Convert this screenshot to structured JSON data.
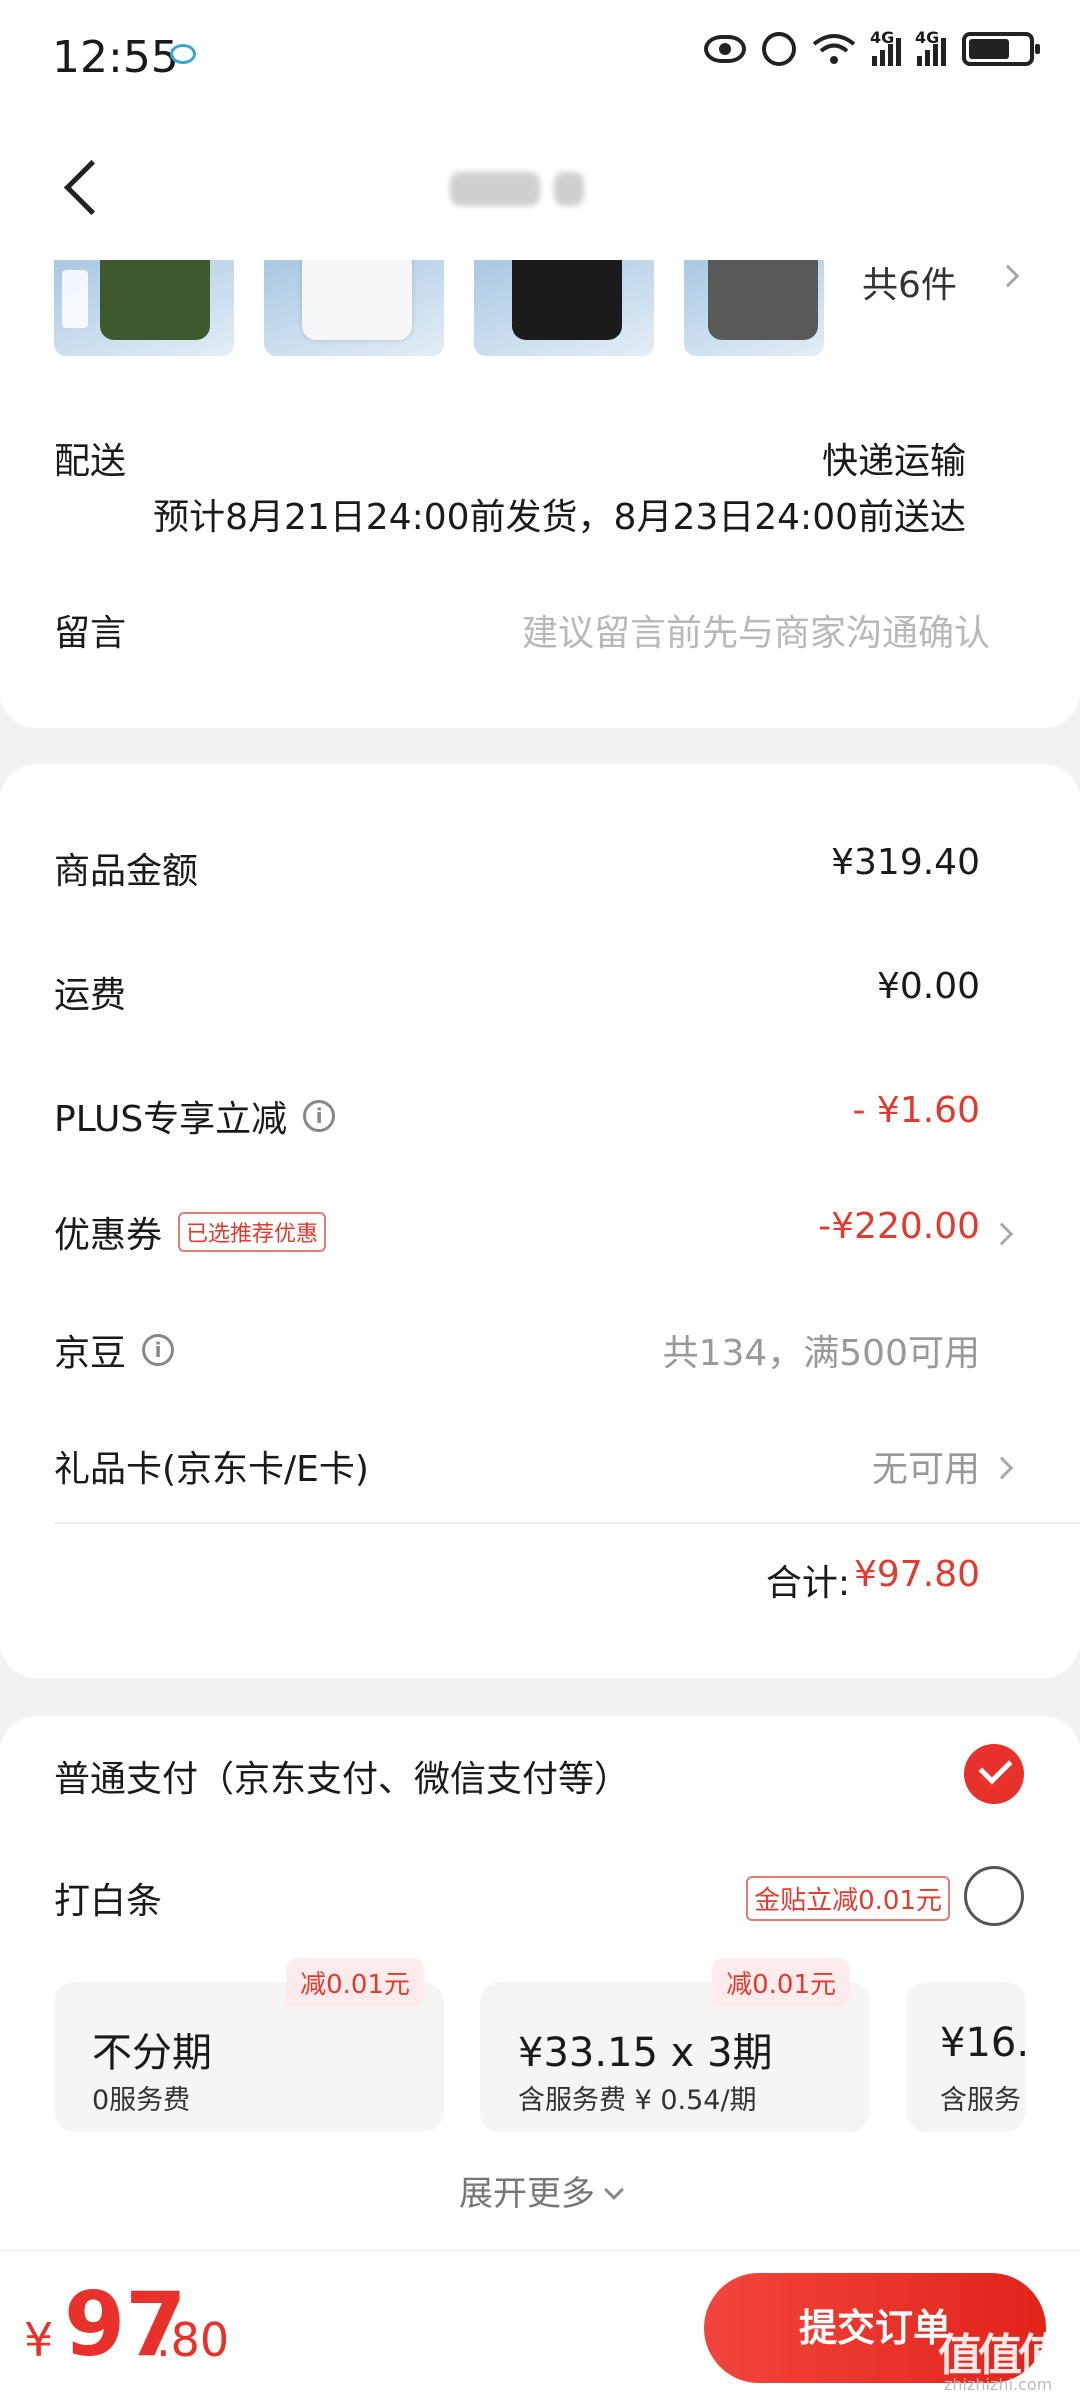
{
  "status_bar": {
    "time": "12:55",
    "signal1": "4G",
    "signal2": "4G"
  },
  "navbar": {
    "title": ""
  },
  "order": {
    "item_count": "共6件",
    "delivery_label": "配送",
    "delivery_value": "快递运输",
    "delivery_date": "预计8月21日24:00前发货，8月23日24:00前送达",
    "message_label": "留言",
    "message_placeholder": "建议留言前先与商家沟通确认"
  },
  "price": {
    "goods_label": "商品金额",
    "goods_value": "¥319.40",
    "shipping_label": "运费",
    "shipping_value": "¥0.00",
    "plus_label": "PLUS专享立减",
    "plus_value": "- ¥1.60",
    "coupon_label": "优惠券",
    "coupon_tag": "已选推荐优惠",
    "coupon_value": "-¥220.00",
    "beans_label": "京豆",
    "beans_value": "共134，满500可用",
    "giftcard_label": "礼品卡(京东卡/E卡)",
    "giftcard_value": "无可用",
    "total_label": "合计:",
    "total_value": "¥97.80"
  },
  "payment": {
    "normal_label": "普通支付（京东支付、微信支付等）",
    "baitiao_label": "打白条",
    "baitiao_promo": "金贴立减0.01元",
    "plans": [
      {
        "main": "不分期",
        "sub": "0服务费",
        "badge": "减0.01元"
      },
      {
        "main": "¥33.15 x 3期",
        "sub": "含服务费 ¥ 0.54/期",
        "badge": "减0.01元"
      },
      {
        "main": "¥16.",
        "sub": "含服务",
        "badge": ""
      }
    ],
    "expand_label": "展开更多"
  },
  "bottom": {
    "yen": "¥",
    "amount_int": "97",
    "amount_dec": ".80",
    "submit_label": "提交订单",
    "watermark": "值值值",
    "watermark_sub": "zhizhizhi.com"
  },
  "colors": {
    "accent": "#e8312a",
    "accent_text": "#e03b2f",
    "muted": "#999999"
  }
}
